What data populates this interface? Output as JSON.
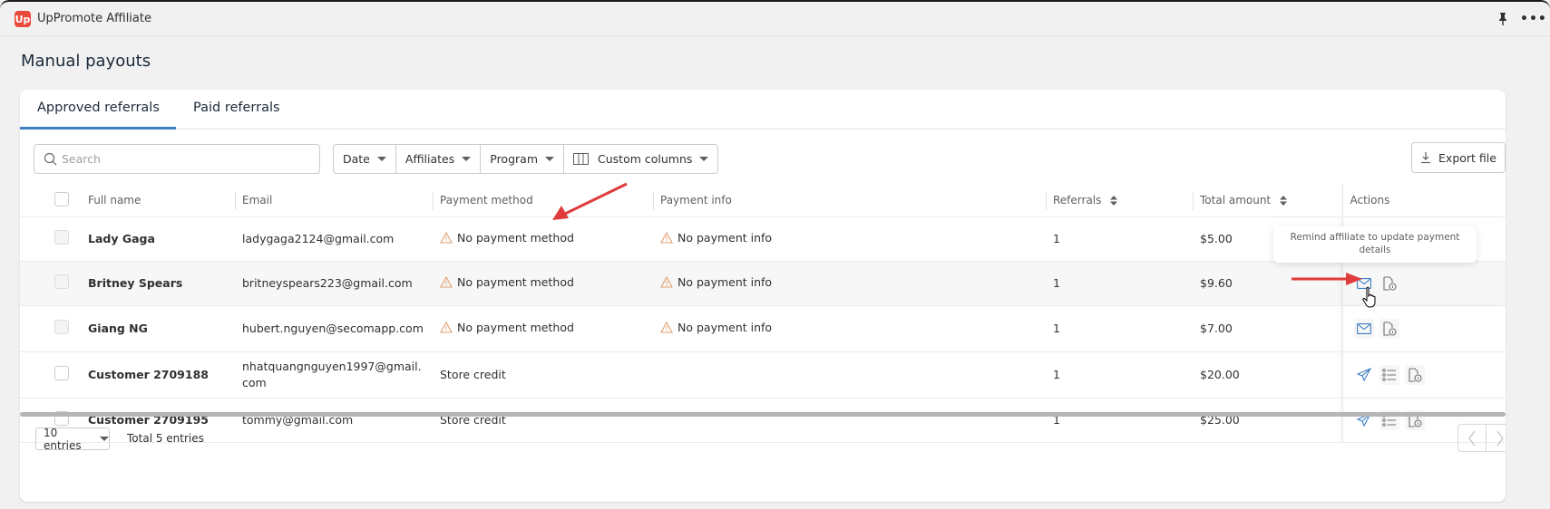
{
  "app": {
    "title": "UpPromote Affiliate",
    "logo_glyph": "Up",
    "pin_icon": "pin-icon",
    "more_icon": "more-horizontal-icon",
    "more_label": "•••"
  },
  "page": {
    "title": "Manual payouts"
  },
  "tabs": [
    {
      "label": "Approved referrals",
      "active": true
    },
    {
      "label": "Paid referrals",
      "active": false
    }
  ],
  "toolbar": {
    "search_placeholder": "Search",
    "search_value": "",
    "filters": [
      {
        "label": "Date"
      },
      {
        "label": "Affiliates"
      },
      {
        "label": "Program"
      },
      {
        "label": "Custom columns",
        "icon": "columns-icon"
      }
    ],
    "export_label": "Export file"
  },
  "table": {
    "columns": [
      "Full name",
      "Email",
      "Payment method",
      "Payment info",
      "Referrals",
      "Total amount",
      "Actions"
    ],
    "sortable": [
      "Referrals",
      "Total amount"
    ],
    "rows": [
      {
        "name": "Lady Gaga",
        "email": "ladygaga2124@gmail.com",
        "payment_method": "No payment method",
        "payment_method_warning": true,
        "payment_info": "No payment info",
        "payment_info_warning": true,
        "referrals": "1",
        "total": "$5.00",
        "actions": [
          "remind-email",
          "payment-info-doc"
        ]
      },
      {
        "name": "Britney Spears",
        "email": "britneyspears223@gmail.com",
        "payment_method": "No payment method",
        "payment_method_warning": true,
        "payment_info": "No payment info",
        "payment_info_warning": true,
        "referrals": "1",
        "total": "$9.60",
        "actions": [
          "remind-email",
          "payment-info-doc"
        ]
      },
      {
        "name": "Giang NG",
        "email": "hubert.nguyen@secomapp.com",
        "payment_method": "No payment method",
        "payment_method_warning": true,
        "payment_info": "No payment info",
        "payment_info_warning": true,
        "referrals": "1",
        "total": "$7.00",
        "actions": [
          "remind-email",
          "payment-info-doc"
        ]
      },
      {
        "name": "Customer 2709188",
        "email": "nhatquangnguyen1997@gmail.com",
        "payment_method": "Store credit",
        "payment_method_warning": false,
        "payment_info": "",
        "payment_info_warning": false,
        "referrals": "1",
        "total": "$20.00",
        "actions": [
          "send-payment",
          "details-list",
          "payment-info-doc"
        ]
      },
      {
        "name": "Customer 2709195",
        "email": "tommy@gmail.com",
        "payment_method": "Store credit",
        "payment_method_warning": false,
        "payment_info": "",
        "payment_info_warning": false,
        "referrals": "1",
        "total": "$25.00",
        "actions": [
          "send-payment",
          "details-list",
          "payment-info-doc"
        ]
      }
    ]
  },
  "tooltip": {
    "text": "Remind affiliate to update payment details"
  },
  "footer": {
    "page_size": "10 entries",
    "total": "Total 5 entries"
  },
  "colors": {
    "accent": "#3d7ec4",
    "warning": "#e0a070",
    "annotation_arrow": "#e03c3c",
    "logo": "#ea4a3c"
  }
}
